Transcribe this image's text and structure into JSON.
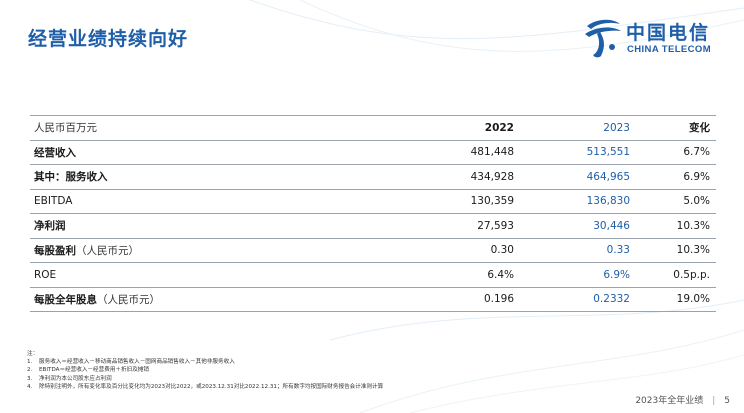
{
  "title": "经营业绩持续向好",
  "logo": {
    "cn": "中国电信",
    "en": "CHINA TELECOM"
  },
  "table": {
    "header": {
      "unit": "人民币百万元",
      "y2022": "2022",
      "y2023": "2023",
      "change": "变化"
    },
    "rows": [
      {
        "label": "经营收入",
        "label_suffix": "",
        "v2022": "481,448",
        "v2023": "513,551",
        "change": "6.7%"
      },
      {
        "label": "其中：服务收入",
        "label_suffix": "",
        "v2022": "434,928",
        "v2023": "464,965",
        "change": "6.9%"
      },
      {
        "label": "EBITDA",
        "label_suffix": "",
        "v2022": "130,359",
        "v2023": "136,830",
        "change": "5.0%"
      },
      {
        "label": "净利润",
        "label_suffix": "",
        "v2022": "27,593",
        "v2023": "30,446",
        "change": "10.3%"
      },
      {
        "label": "每股盈利",
        "label_suffix": "（人民币元）",
        "v2022": "0.30",
        "v2023": "0.33",
        "change": "10.3%"
      },
      {
        "label": "ROE",
        "label_suffix": "",
        "v2022": "6.4%",
        "v2023": "6.9%",
        "change": "0.5p.p."
      },
      {
        "label": "每股全年股息",
        "label_suffix": "（人民币元）",
        "v2022": "0.196",
        "v2023": "0.2332",
        "change": "19.0%"
      }
    ]
  },
  "notes": {
    "heading": "注：",
    "items": [
      {
        "num": "1.",
        "text": "服务收入＝经营收入－移动商品销售收入－固网商品销售收入－其他非服务收入"
      },
      {
        "num": "2.",
        "text": "EBITDA＝经营收入－经营费用＋折旧及摊销"
      },
      {
        "num": "3.",
        "text": "净利润为本公司股东应占利润"
      },
      {
        "num": "4.",
        "text": "除特别注明外，所有变化率及百分比变化均为2023对比2022，或2023.12.31对比2022.12.31；所有数字均按国际财务报告会计准则计算"
      }
    ]
  },
  "footer": {
    "text": "2023年全年业绩",
    "page": "5"
  },
  "colors": {
    "brand_blue": "#1f5ea8",
    "rule_gray": "#9aa3ad"
  }
}
